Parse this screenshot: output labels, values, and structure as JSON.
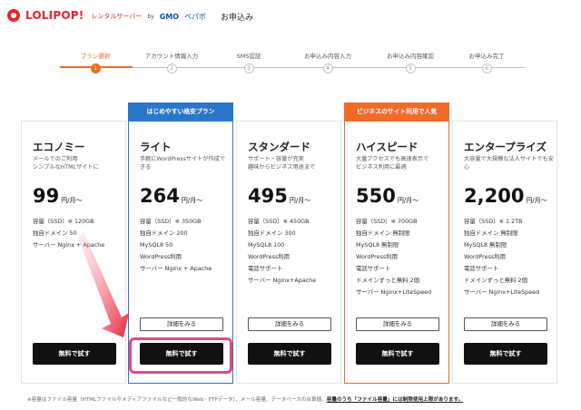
{
  "header": {
    "logo": "LOLIPOP!",
    "logo_sub": "レンタルサーバー",
    "by": "by",
    "gmo": "GMO",
    "gmo_kana": "ペパボ",
    "title": "お申込み"
  },
  "steps": [
    {
      "label": "プラン選択",
      "num": "1",
      "active": true
    },
    {
      "label": "アカウント情報入力",
      "num": "2",
      "active": false
    },
    {
      "label": "SMS認証",
      "num": "3",
      "active": false
    },
    {
      "label": "お申込み内容入力",
      "num": "4",
      "active": false
    },
    {
      "label": "お申込み内容確認",
      "num": "5",
      "active": false
    },
    {
      "label": "お申込み完了",
      "num": "6",
      "active": false
    }
  ],
  "ribbons": {
    "lite": "はじめやすい格安プラン",
    "highspeed": "ビジネスのサイト利用で人気"
  },
  "plans": [
    {
      "name": "エコノミー",
      "desc": "メールでのご利用\nシンプルなHTMLサイトに",
      "price": "99",
      "unit": "円/月〜",
      "specs": [
        "容量（SSD）※ 120GB",
        "独自ドメイン 50",
        "サーバー Nginx + Apache"
      ],
      "detail": "",
      "try": "無料で試す"
    },
    {
      "name": "ライト",
      "desc": "手軽にWordPressサイトが作成できる",
      "price": "264",
      "unit": "円/月〜",
      "specs": [
        "容量（SSD）※ 350GB",
        "独自ドメイン 200",
        "MySQL8 50",
        "WordPress利用",
        "サーバー Nginx + Apache"
      ],
      "detail": "詳細をみる",
      "try": "無料で試す"
    },
    {
      "name": "スタンダード",
      "desc": "サポート・容量が充実\n趣味からビジネス用途まで",
      "price": "495",
      "unit": "円/月〜",
      "specs": [
        "容量（SSD）※ 450GB",
        "独自ドメイン 300",
        "MySQL8 100",
        "WordPress利用",
        "電話サポート",
        "サーバー Nginx+Apache"
      ],
      "detail": "詳細をみる",
      "try": "無料で試す"
    },
    {
      "name": "ハイスピード",
      "desc": "大量アクセスでも高速表示で\nビジネス利用に最適",
      "price": "550",
      "unit": "円/月〜",
      "specs": [
        "容量（SSD）※ 700GB",
        "独自ドメイン 無制限",
        "MySQL8 無制限",
        "WordPress利用",
        "電話サポート",
        "ドメインずっと無料 2個",
        "サーバー Nginx+LiteSpeed"
      ],
      "detail": "詳細をみる",
      "try": "無料で試す"
    },
    {
      "name": "エンタープライズ",
      "desc": "大容量で大規模な法人サイトでも安心",
      "price": "2,200",
      "unit": "円/月〜",
      "specs": [
        "容量（SSD）※ 1.2TB",
        "独自ドメイン 無制限",
        "MySQL8 無制限",
        "WordPress利用",
        "電話サポート",
        "ドメインずっと無料 2個",
        "サーバー Nginx+LiteSpeed"
      ],
      "detail": "詳細をみる",
      "try": "無料で試す"
    }
  ],
  "footnote": {
    "text": "※容量はファイル容量（HTMLファイルやメディアファイルなど一般的なWeb・FTPデータ）、メール容量、データベースの合算値。",
    "link": "容量のうち「ファイル容量」には制限使用上限があります。"
  },
  "colors": {
    "accent": "#f06a2a",
    "blue": "#2a77c9",
    "highlight": "#e9467f",
    "brand": "#e5262a"
  }
}
